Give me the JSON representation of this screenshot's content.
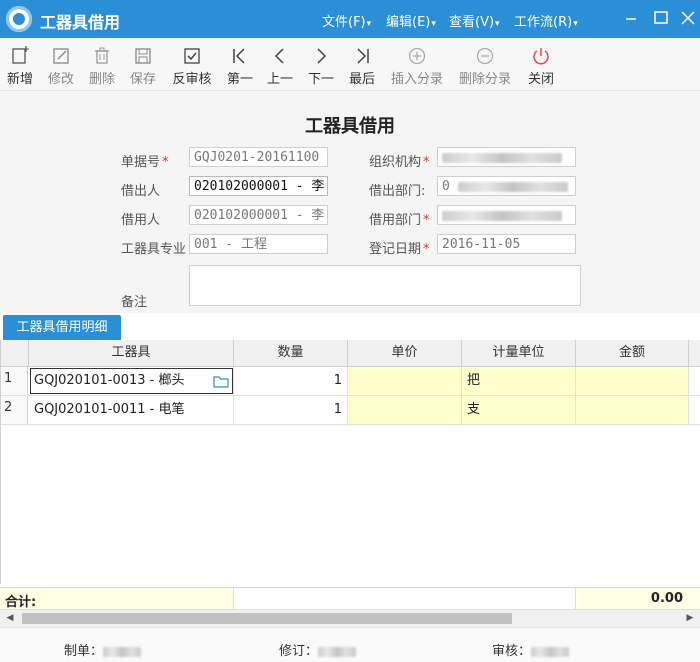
{
  "titlebar": {
    "title": "工器具借用",
    "menus": [
      {
        "label": "文件(F)"
      },
      {
        "label": "编辑(E)"
      },
      {
        "label": "查看(V)"
      },
      {
        "label": "工作流(R)"
      }
    ]
  },
  "toolbar": {
    "add": "新增",
    "edit": "修改",
    "delete": "删除",
    "save": "保存",
    "unaudit": "反审核",
    "first": "第一",
    "prev": "上一",
    "next": "下一",
    "last": "最后",
    "insert_entry": "插入分录",
    "delete_entry": "删除分录",
    "close": "关闭"
  },
  "form": {
    "title": "工器具借用",
    "bill_no_label": "单据号",
    "bill_no": "GQJ0201-20161100",
    "org_label": "组织机构",
    "lender_label": "借出人",
    "lender": "020102000001 - 李",
    "lend_dept_label": "借出部门",
    "lend_dept_prefix": "0",
    "borrower_label": "借用人",
    "borrower": "020102000001 - 李",
    "borrow_dept_label": "借用部门",
    "specialty_label": "工器具专业",
    "specialty": "001 - 工程",
    "reg_date_label": "登记日期",
    "reg_date": "2016-11-05",
    "remark_label": "备注"
  },
  "tab": {
    "label": "工器具借用明细"
  },
  "grid": {
    "headers": [
      "工器具",
      "数量",
      "单价",
      "计量单位",
      "金额"
    ],
    "rows": [
      {
        "no": "1",
        "tool": "GQJ020101-0013 - 榔头",
        "qty": "1",
        "price": "",
        "unit": "把",
        "amount": ""
      },
      {
        "no": "2",
        "tool": "GQJ020101-0011 - 电笔",
        "qty": "1",
        "price": "",
        "unit": "支",
        "amount": ""
      }
    ],
    "total_label": "合计:",
    "total_amount": "0.00"
  },
  "footer": {
    "maker_label": "制单：",
    "reviser_label": "修订：",
    "auditor_label": "审核："
  },
  "colors": {
    "accent": "#2a8fd6",
    "required": "#d9302c",
    "editable_cell": "#ffffcc"
  }
}
